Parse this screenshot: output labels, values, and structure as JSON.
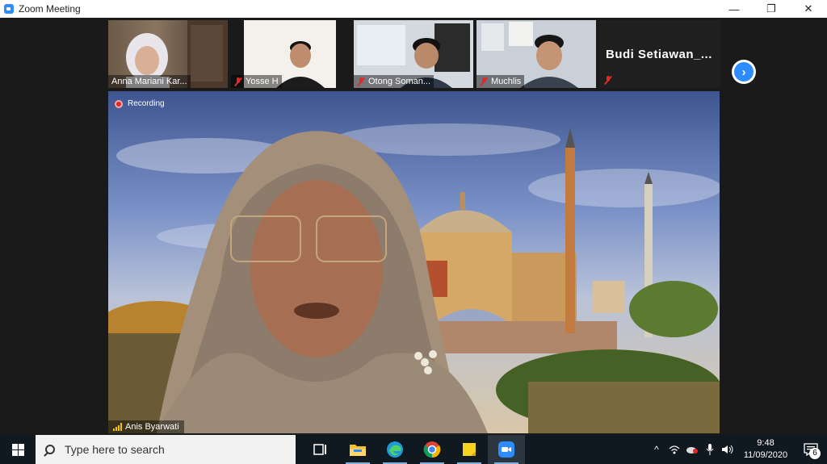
{
  "window": {
    "title": "Zoom Meeting",
    "controls": {
      "minimize": "—",
      "restore": "❐",
      "close": "✕"
    }
  },
  "participants": [
    {
      "name": "Anna Mariani Kar...",
      "muted": false
    },
    {
      "name": "Yosse H",
      "muted": true
    },
    {
      "name": "Otong Soman...",
      "muted": true
    },
    {
      "name": "Muchlis",
      "muted": true
    },
    {
      "name": "Budi  Setiawan_...",
      "muted": true,
      "video": false
    }
  ],
  "main_video": {
    "recording_label": "Recording",
    "speaker_name": "Anis Byarwati"
  },
  "taskbar": {
    "search_placeholder": "Type here to search",
    "apps": [
      "task-view",
      "file-explorer",
      "edge",
      "chrome",
      "sticky-notes",
      "zoom"
    ],
    "clock_time": "9:48",
    "clock_date": "11/09/2020",
    "notification_count": "6"
  },
  "colors": {
    "zoom_blue": "#2d8cff",
    "mute_red": "#e02828",
    "taskbar_bg": "#101820"
  }
}
